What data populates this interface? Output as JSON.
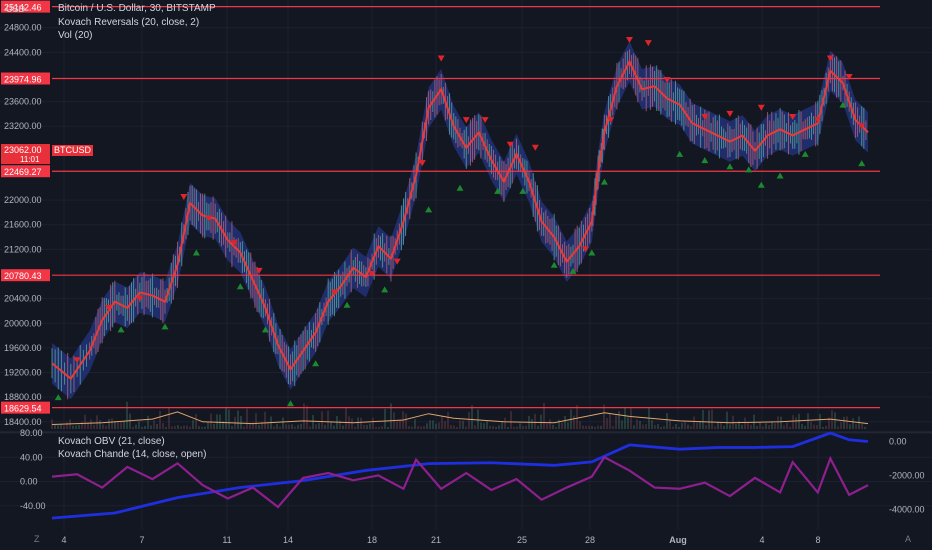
{
  "header": {
    "currency": "USD",
    "title": "Bitcoin / U.S. Dollar, 30, BITSTAMP",
    "indicator_1": "Kovach Reversals (20, close, 2)",
    "indicator_2": "Vol (20)"
  },
  "price_axis": {
    "labels": [
      "24800.00",
      "24400.00",
      "23600.00",
      "23200.00",
      "22000.00",
      "21600.00",
      "21200.00",
      "20400.00",
      "20000.00",
      "19600.00",
      "19200.00",
      "18800.00",
      "18400.00"
    ],
    "symbol_tag": "BTCUSD",
    "current_price": "23062.00",
    "countdown": "11:01"
  },
  "levels": [
    {
      "label": "25142.46",
      "value": 25142.46
    },
    {
      "label": "23974.96",
      "value": 23974.96
    },
    {
      "label": "22469.27",
      "value": 22469.27
    },
    {
      "label": "20780.43",
      "value": 20780.43
    },
    {
      "label": "18629.54",
      "value": 18629.54
    }
  ],
  "lower_pane": {
    "title_1": "Kovach OBV (21, close)",
    "title_2": "Kovach Chande (14, close, open)",
    "left_labels": [
      "80.00",
      "40.00",
      "0.00",
      "-40.00"
    ],
    "right_labels": [
      "0.00",
      "-2000.00",
      "-4000.00"
    ]
  },
  "time_axis": {
    "labels": [
      {
        "text": "4",
        "bold": false
      },
      {
        "text": "7",
        "bold": false
      },
      {
        "text": "11",
        "bold": false
      },
      {
        "text": "14",
        "bold": false
      },
      {
        "text": "18",
        "bold": false
      },
      {
        "text": "21",
        "bold": false
      },
      {
        "text": "25",
        "bold": false
      },
      {
        "text": "28",
        "bold": false
      },
      {
        "text": "Aug",
        "bold": true
      },
      {
        "text": "4",
        "bold": false
      },
      {
        "text": "8",
        "bold": false
      }
    ]
  },
  "footer": {
    "left_icon": "Z",
    "right_icon": "A"
  },
  "colors": {
    "background": "#131722",
    "level_line": "#f23645",
    "price_line": "#e83a3a",
    "band": "#2b3fa8",
    "obv": "#1f2fe0",
    "chande": "#8e1f8e",
    "buy": "#1b8a2e",
    "sell": "#e0242a"
  },
  "chart_data": {
    "type": "line",
    "price_series": [
      {
        "x": 0,
        "y": 19350
      },
      {
        "x": 3,
        "y": 19100
      },
      {
        "x": 6,
        "y": 19550
      },
      {
        "x": 8,
        "y": 20050
      },
      {
        "x": 10,
        "y": 20350
      },
      {
        "x": 12,
        "y": 20250
      },
      {
        "x": 14,
        "y": 20500
      },
      {
        "x": 16,
        "y": 20450
      },
      {
        "x": 18,
        "y": 20350
      },
      {
        "x": 20,
        "y": 20950
      },
      {
        "x": 22,
        "y": 21950
      },
      {
        "x": 24,
        "y": 21750
      },
      {
        "x": 26,
        "y": 21700
      },
      {
        "x": 28,
        "y": 21350
      },
      {
        "x": 30,
        "y": 21150
      },
      {
        "x": 32,
        "y": 20700
      },
      {
        "x": 34,
        "y": 20250
      },
      {
        "x": 36,
        "y": 19650
      },
      {
        "x": 38,
        "y": 19250
      },
      {
        "x": 40,
        "y": 19550
      },
      {
        "x": 42,
        "y": 19850
      },
      {
        "x": 44,
        "y": 20350
      },
      {
        "x": 46,
        "y": 20600
      },
      {
        "x": 48,
        "y": 20900
      },
      {
        "x": 50,
        "y": 20750
      },
      {
        "x": 52,
        "y": 21250
      },
      {
        "x": 54,
        "y": 21050
      },
      {
        "x": 56,
        "y": 21650
      },
      {
        "x": 58,
        "y": 22400
      },
      {
        "x": 60,
        "y": 23500
      },
      {
        "x": 62,
        "y": 23800
      },
      {
        "x": 64,
        "y": 23200
      },
      {
        "x": 66,
        "y": 22850
      },
      {
        "x": 68,
        "y": 23100
      },
      {
        "x": 70,
        "y": 22650
      },
      {
        "x": 72,
        "y": 22300
      },
      {
        "x": 74,
        "y": 22750
      },
      {
        "x": 76,
        "y": 22300
      },
      {
        "x": 78,
        "y": 21650
      },
      {
        "x": 80,
        "y": 21400
      },
      {
        "x": 82,
        "y": 21000
      },
      {
        "x": 84,
        "y": 21250
      },
      {
        "x": 86,
        "y": 21650
      },
      {
        "x": 87,
        "y": 22450
      },
      {
        "x": 88,
        "y": 23100
      },
      {
        "x": 90,
        "y": 23850
      },
      {
        "x": 92,
        "y": 24250
      },
      {
        "x": 94,
        "y": 23800
      },
      {
        "x": 96,
        "y": 23850
      },
      {
        "x": 98,
        "y": 23650
      },
      {
        "x": 100,
        "y": 23550
      },
      {
        "x": 102,
        "y": 23250
      },
      {
        "x": 104,
        "y": 23150
      },
      {
        "x": 106,
        "y": 23050
      },
      {
        "x": 108,
        "y": 22950
      },
      {
        "x": 110,
        "y": 23050
      },
      {
        "x": 112,
        "y": 22800
      },
      {
        "x": 114,
        "y": 23050
      },
      {
        "x": 116,
        "y": 23150
      },
      {
        "x": 118,
        "y": 23050
      },
      {
        "x": 120,
        "y": 23150
      },
      {
        "x": 122,
        "y": 23250
      },
      {
        "x": 124,
        "y": 24100
      },
      {
        "x": 126,
        "y": 23900
      },
      {
        "x": 128,
        "y": 23300
      },
      {
        "x": 130,
        "y": 23100
      }
    ],
    "obv_series": [
      {
        "x": 0,
        "y": -4500
      },
      {
        "x": 10,
        "y": -4200
      },
      {
        "x": 20,
        "y": -3300
      },
      {
        "x": 30,
        "y": -2700
      },
      {
        "x": 40,
        "y": -2300
      },
      {
        "x": 50,
        "y": -1700
      },
      {
        "x": 60,
        "y": -1300
      },
      {
        "x": 70,
        "y": -1250
      },
      {
        "x": 80,
        "y": -1400
      },
      {
        "x": 86,
        "y": -1200
      },
      {
        "x": 92,
        "y": -200
      },
      {
        "x": 100,
        "y": -450
      },
      {
        "x": 106,
        "y": -350
      },
      {
        "x": 112,
        "y": -350
      },
      {
        "x": 118,
        "y": -300
      },
      {
        "x": 124,
        "y": 500
      },
      {
        "x": 127,
        "y": 100
      },
      {
        "x": 130,
        "y": 0
      }
    ],
    "chande_series": [
      {
        "x": 0,
        "y": 8
      },
      {
        "x": 4,
        "y": 12
      },
      {
        "x": 8,
        "y": -10
      },
      {
        "x": 12,
        "y": 24
      },
      {
        "x": 16,
        "y": 4
      },
      {
        "x": 20,
        "y": 30
      },
      {
        "x": 24,
        "y": -6
      },
      {
        "x": 28,
        "y": -28
      },
      {
        "x": 32,
        "y": -10
      },
      {
        "x": 36,
        "y": -42
      },
      {
        "x": 40,
        "y": 6
      },
      {
        "x": 44,
        "y": 14
      },
      {
        "x": 48,
        "y": 2
      },
      {
        "x": 52,
        "y": 10
      },
      {
        "x": 56,
        "y": -12
      },
      {
        "x": 58,
        "y": 36
      },
      {
        "x": 62,
        "y": -12
      },
      {
        "x": 66,
        "y": 14
      },
      {
        "x": 70,
        "y": -14
      },
      {
        "x": 74,
        "y": 4
      },
      {
        "x": 78,
        "y": -30
      },
      {
        "x": 82,
        "y": -10
      },
      {
        "x": 86,
        "y": 8
      },
      {
        "x": 88,
        "y": 40
      },
      {
        "x": 92,
        "y": 18
      },
      {
        "x": 96,
        "y": -10
      },
      {
        "x": 100,
        "y": -12
      },
      {
        "x": 104,
        "y": -2
      },
      {
        "x": 108,
        "y": -24
      },
      {
        "x": 112,
        "y": 6
      },
      {
        "x": 116,
        "y": -18
      },
      {
        "x": 118,
        "y": 32
      },
      {
        "x": 122,
        "y": -18
      },
      {
        "x": 124,
        "y": 38
      },
      {
        "x": 127,
        "y": -22
      },
      {
        "x": 130,
        "y": -6
      }
    ],
    "sell_signals": [
      {
        "x": 4,
        "y": 19400
      },
      {
        "x": 9,
        "y": 20250
      },
      {
        "x": 14,
        "y": 20400
      },
      {
        "x": 21,
        "y": 22050
      },
      {
        "x": 25,
        "y": 21700
      },
      {
        "x": 29,
        "y": 21300
      },
      {
        "x": 33,
        "y": 20850
      },
      {
        "x": 45,
        "y": 20500
      },
      {
        "x": 51,
        "y": 20800
      },
      {
        "x": 55,
        "y": 21000
      },
      {
        "x": 59,
        "y": 22600
      },
      {
        "x": 62,
        "y": 24300
      },
      {
        "x": 66,
        "y": 23300
      },
      {
        "x": 69,
        "y": 23300
      },
      {
        "x": 73,
        "y": 22900
      },
      {
        "x": 77,
        "y": 22850
      },
      {
        "x": 85,
        "y": 21200
      },
      {
        "x": 89,
        "y": 23300
      },
      {
        "x": 92,
        "y": 24600
      },
      {
        "x": 95,
        "y": 24550
      },
      {
        "x": 98,
        "y": 23950
      },
      {
        "x": 104,
        "y": 23350
      },
      {
        "x": 108,
        "y": 23400
      },
      {
        "x": 113,
        "y": 23500
      },
      {
        "x": 118,
        "y": 23350
      },
      {
        "x": 122,
        "y": 23300
      },
      {
        "x": 124,
        "y": 24300
      },
      {
        "x": 127,
        "y": 24000
      },
      {
        "x": 129,
        "y": 23200
      }
    ],
    "buy_signals": [
      {
        "x": 1,
        "y": 18800
      },
      {
        "x": 11,
        "y": 19900
      },
      {
        "x": 18,
        "y": 19950
      },
      {
        "x": 23,
        "y": 21150
      },
      {
        "x": 30,
        "y": 20600
      },
      {
        "x": 34,
        "y": 19900
      },
      {
        "x": 38,
        "y": 18700
      },
      {
        "x": 42,
        "y": 19350
      },
      {
        "x": 47,
        "y": 20300
      },
      {
        "x": 53,
        "y": 20550
      },
      {
        "x": 60,
        "y": 21850
      },
      {
        "x": 65,
        "y": 22200
      },
      {
        "x": 71,
        "y": 22150
      },
      {
        "x": 75,
        "y": 22150
      },
      {
        "x": 80,
        "y": 20950
      },
      {
        "x": 83,
        "y": 20850
      },
      {
        "x": 86,
        "y": 21150
      },
      {
        "x": 88,
        "y": 22300
      },
      {
        "x": 100,
        "y": 22750
      },
      {
        "x": 104,
        "y": 22650
      },
      {
        "x": 108,
        "y": 22550
      },
      {
        "x": 111,
        "y": 22500
      },
      {
        "x": 113,
        "y": 22250
      },
      {
        "x": 116,
        "y": 22400
      },
      {
        "x": 120,
        "y": 22750
      },
      {
        "x": 126,
        "y": 23550
      },
      {
        "x": 129,
        "y": 22600
      }
    ],
    "volume_avg": [
      {
        "x": 0,
        "y": 0.25
      },
      {
        "x": 8,
        "y": 0.35
      },
      {
        "x": 16,
        "y": 0.55
      },
      {
        "x": 20,
        "y": 0.95
      },
      {
        "x": 24,
        "y": 0.4
      },
      {
        "x": 32,
        "y": 0.3
      },
      {
        "x": 40,
        "y": 0.45
      },
      {
        "x": 48,
        "y": 0.35
      },
      {
        "x": 56,
        "y": 0.5
      },
      {
        "x": 60,
        "y": 0.85
      },
      {
        "x": 64,
        "y": 0.6
      },
      {
        "x": 72,
        "y": 0.4
      },
      {
        "x": 80,
        "y": 0.35
      },
      {
        "x": 88,
        "y": 0.9
      },
      {
        "x": 92,
        "y": 0.7
      },
      {
        "x": 100,
        "y": 0.45
      },
      {
        "x": 108,
        "y": 0.35
      },
      {
        "x": 116,
        "y": 0.4
      },
      {
        "x": 124,
        "y": 0.55
      },
      {
        "x": 130,
        "y": 0.3
      }
    ],
    "ylim_price": [
      18250,
      25250
    ],
    "ylim_chande": [
      -80,
      80
    ],
    "ylim_obv": [
      -5200,
      500
    ],
    "xlim": [
      0,
      130
    ]
  }
}
